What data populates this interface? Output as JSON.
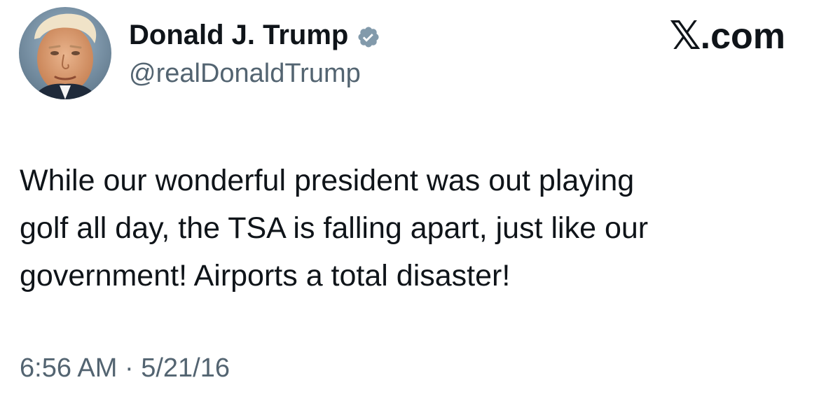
{
  "author": {
    "display_name": "Donald J. Trump",
    "handle": "@realDonaldTrump",
    "verified": true,
    "verified_color": "#829aab"
  },
  "brand": {
    "mark": "𝕏",
    "suffix": ".com"
  },
  "tweet": {
    "lines": [
      "While our wonderful president was out playing",
      "golf all day, the TSA is falling apart, just like our",
      "government! Airports a total disaster!"
    ]
  },
  "timestamp": {
    "time": "6:56 AM",
    "separator": "·",
    "date": "5/21/16"
  },
  "colors": {
    "text": "#0f1419",
    "secondary": "#536471",
    "background": "#ffffff"
  }
}
